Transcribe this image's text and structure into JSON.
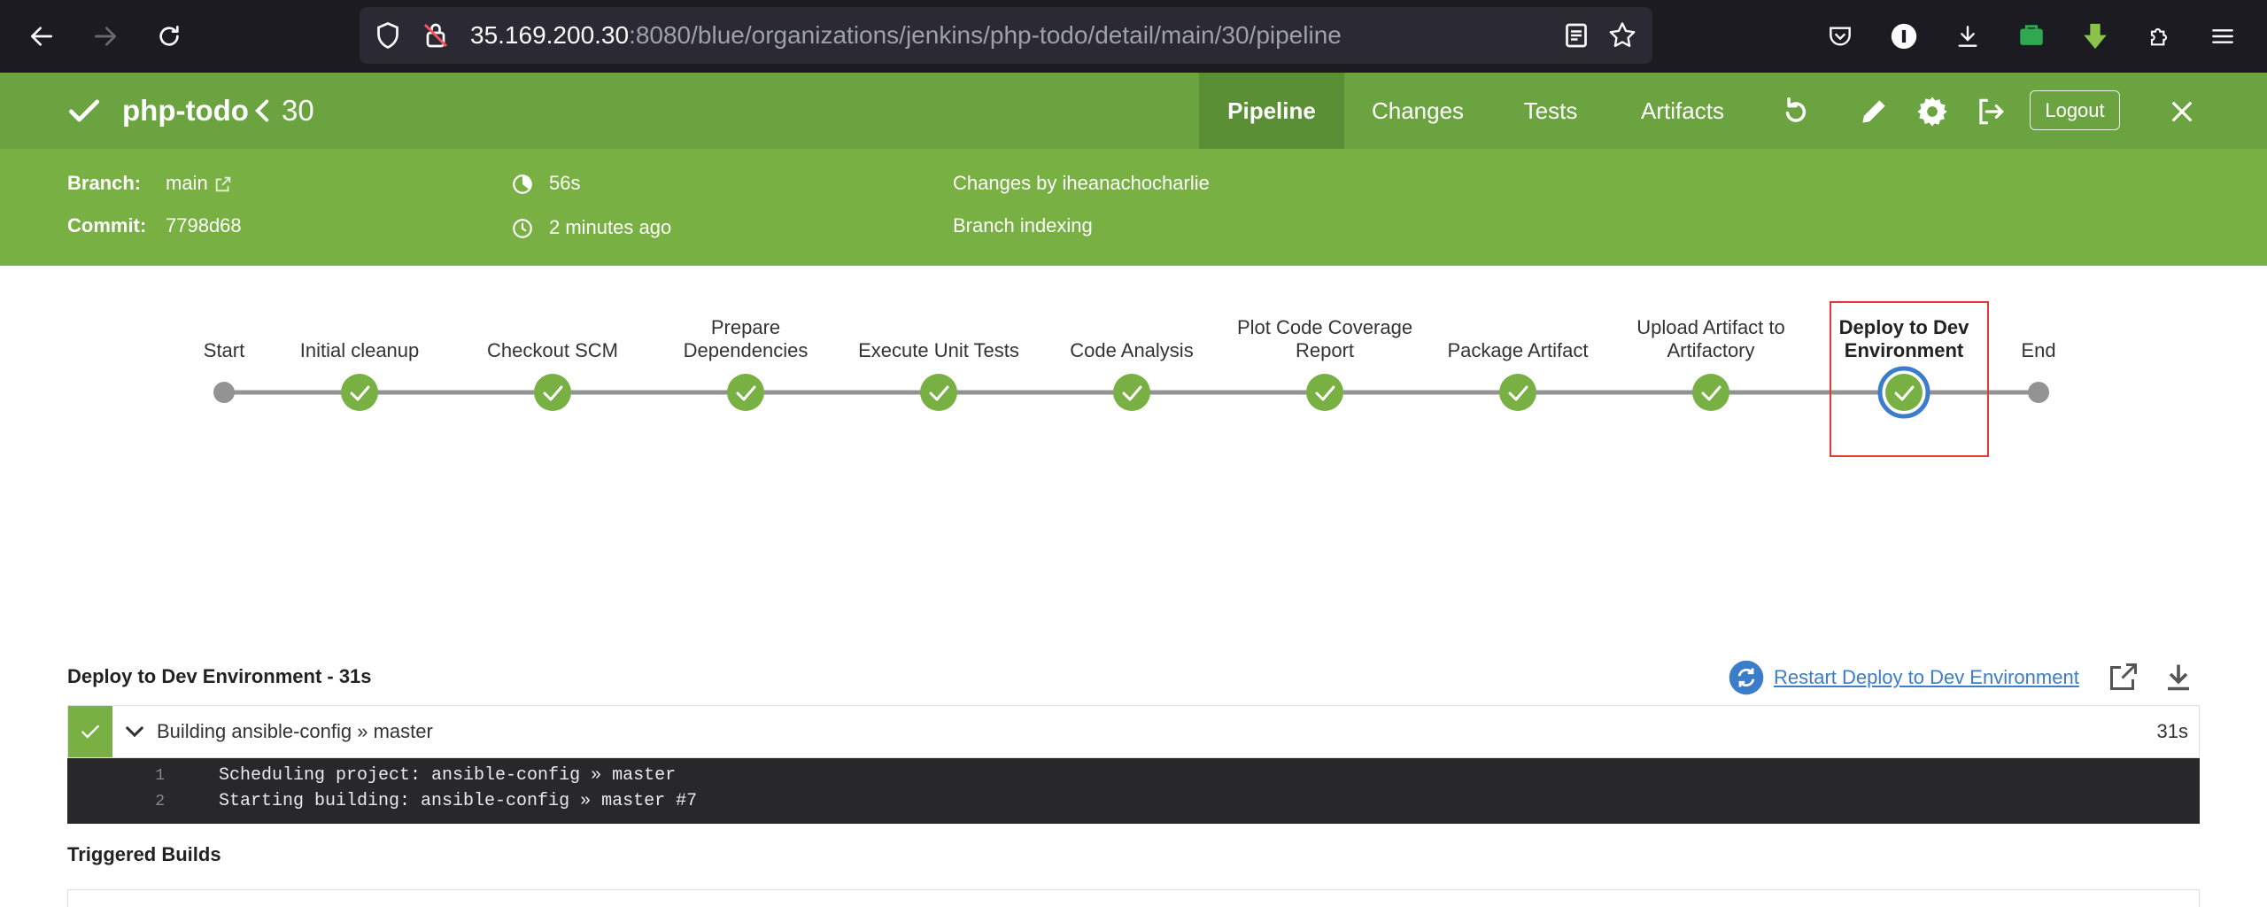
{
  "browser": {
    "url_host": "35.169.200.30",
    "url_rest": ":8080/blue/organizations/jenkins/php-todo/detail/main/30/pipeline"
  },
  "header": {
    "job_name": "php-todo",
    "run_number": "30",
    "tabs": [
      "Pipeline",
      "Changes",
      "Tests",
      "Artifacts"
    ],
    "active_tab": "Pipeline",
    "logout_label": "Logout"
  },
  "meta": {
    "branch_label": "Branch:",
    "branch_value": "main",
    "commit_label": "Commit:",
    "commit_value": "7798d68",
    "duration": "56s",
    "started": "2 minutes ago",
    "changes_by": "Changes by iheanachocharlie",
    "cause": "Branch indexing"
  },
  "pipeline": {
    "stages": [
      {
        "label_lines": [
          "Start"
        ],
        "status": "none"
      },
      {
        "label_lines": [
          "Initial cleanup"
        ],
        "status": "success"
      },
      {
        "label_lines": [
          "Checkout SCM"
        ],
        "status": "success"
      },
      {
        "label_lines": [
          "Prepare",
          "Dependencies"
        ],
        "status": "success"
      },
      {
        "label_lines": [
          "Execute Unit Tests"
        ],
        "status": "success"
      },
      {
        "label_lines": [
          "Code Analysis"
        ],
        "status": "success"
      },
      {
        "label_lines": [
          "Plot Code Coverage",
          "Report"
        ],
        "status": "success"
      },
      {
        "label_lines": [
          "Package Artifact"
        ],
        "status": "success"
      },
      {
        "label_lines": [
          "Upload Artifact to",
          "Artifactory"
        ],
        "status": "success"
      },
      {
        "label_lines": [
          "Deploy to Dev",
          "Environment"
        ],
        "status": "success",
        "selected": true
      },
      {
        "label_lines": [
          "End"
        ],
        "status": "none"
      }
    ]
  },
  "stage_detail": {
    "title": "Deploy to Dev Environment - 31s",
    "restart_label": "Restart Deploy to Dev Environment",
    "step_label": "Building ansible-config » master",
    "step_duration": "31s",
    "log_lines": [
      {
        "n": "1",
        "text": "Scheduling project: ansible-config » master"
      },
      {
        "n": "2",
        "text": "Starting building: ansible-config » master #7"
      }
    ],
    "triggered_title": "Triggered Builds"
  },
  "colors": {
    "header_green": "#6aa33f",
    "subheader_green": "#78b043",
    "success_node": "#78b043",
    "selected_ring": "#3b7ccb",
    "link_blue": "#3b7ccb"
  }
}
